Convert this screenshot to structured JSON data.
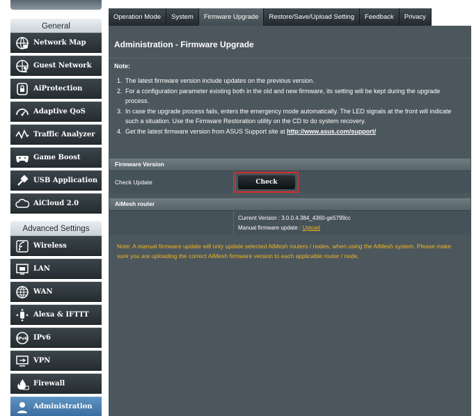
{
  "sidebar": {
    "general_header": "General",
    "general_items": [
      {
        "label": "Network Map",
        "icon": "network-map-icon"
      },
      {
        "label": "Guest Network",
        "icon": "guest-network-icon"
      },
      {
        "label": "AiProtection",
        "icon": "lock-icon"
      },
      {
        "label": "Adaptive QoS",
        "icon": "gauge-icon"
      },
      {
        "label": "Traffic Analyzer",
        "icon": "traffic-analyzer-icon"
      },
      {
        "label": "Game Boost",
        "icon": "gamepad-icon"
      },
      {
        "label": "USB Application",
        "icon": "usb-icon"
      },
      {
        "label": "AiCloud 2.0",
        "icon": "cloud-icon"
      }
    ],
    "advanced_header": "Advanced Settings",
    "advanced_items": [
      {
        "label": "Wireless",
        "icon": "wireless-icon"
      },
      {
        "label": "LAN",
        "icon": "lan-icon"
      },
      {
        "label": "WAN",
        "icon": "globe-icon"
      },
      {
        "label": "Alexa & IFTTT",
        "icon": "alexa-icon"
      },
      {
        "label": "IPv6",
        "icon": "ipv6-icon"
      },
      {
        "label": "VPN",
        "icon": "vpn-icon"
      },
      {
        "label": "Firewall",
        "icon": "firewall-icon"
      },
      {
        "label": "Administration",
        "icon": "administration-icon",
        "active": true
      }
    ]
  },
  "tabs": [
    {
      "label": "Operation Mode"
    },
    {
      "label": "System"
    },
    {
      "label": "Firmware Upgrade",
      "active": true
    },
    {
      "label": "Restore/Save/Upload Setting"
    },
    {
      "label": "Feedback"
    },
    {
      "label": "Privacy"
    }
  ],
  "main": {
    "title": "Administration - Firmware Upgrade",
    "note_label": "Note:",
    "notes": [
      {
        "num": "1.",
        "text": "The latest firmware version include updates on the previous version."
      },
      {
        "num": "2.",
        "text": "For a configuration parameter existing both in the old and new firmware, its setting will be kept during the upgrade"
      },
      {
        "num": "",
        "text": "process."
      },
      {
        "num": "3.",
        "text": "In case the upgrade process fails, enters the emergency mode automatically. The LED signals at the front will indicate"
      },
      {
        "num": "",
        "text": "such a situation. Use the Firmware Restoration utility on the CD to do system recovery."
      }
    ],
    "note4_prefix": "4.",
    "note4_text": "Get the latest firmware version from ASUS Support site at ",
    "note4_link": "http://www.asus.com/support/",
    "firmware_section": {
      "header": "Firmware Version",
      "row_label": "Check Update",
      "check_button": "Check"
    },
    "aimesh_section": {
      "header": "AiMesh router",
      "current_version": "Current Version : 3.0.0.4.384_4360-ge5799cc",
      "manual_update_label": "Manual firmware update : ",
      "upload_link": "Upload"
    },
    "warning": "Note: A manual firmware update will only update selected AiMesh routers / nodes, when using the AiMesh system. Please make sure you are uploading the correct AiMesh firmware version to each applicable router / node."
  },
  "colors": {
    "panel_bg": "#4c575d",
    "accent_yellow": "#f2b61e",
    "highlight_red": "#d92b2b",
    "active_blue": "#3b6ea0"
  }
}
